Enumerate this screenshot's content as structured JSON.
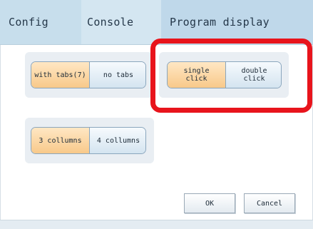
{
  "tabs": {
    "config": "Config",
    "console": "Console",
    "program_display": "Program display"
  },
  "tab_options": {
    "with_tabs": "with tabs(7)",
    "no_tabs": "no tabs",
    "selected": "with tabs(7)"
  },
  "click_options": {
    "single_click": "single\nclick",
    "double_click": "double\nclick",
    "selected": "single click"
  },
  "column_options": {
    "three_columns": "3 collumns",
    "four_columns": "4 collumns",
    "selected": "3 collumns"
  },
  "buttons": {
    "ok": "OK",
    "cancel": "Cancel"
  },
  "colors": {
    "selected_option": "#f8c98a",
    "unselected_option": "#d4e4f0",
    "highlight_frame": "#e8141c",
    "tab_bar": "#dcecf6"
  }
}
